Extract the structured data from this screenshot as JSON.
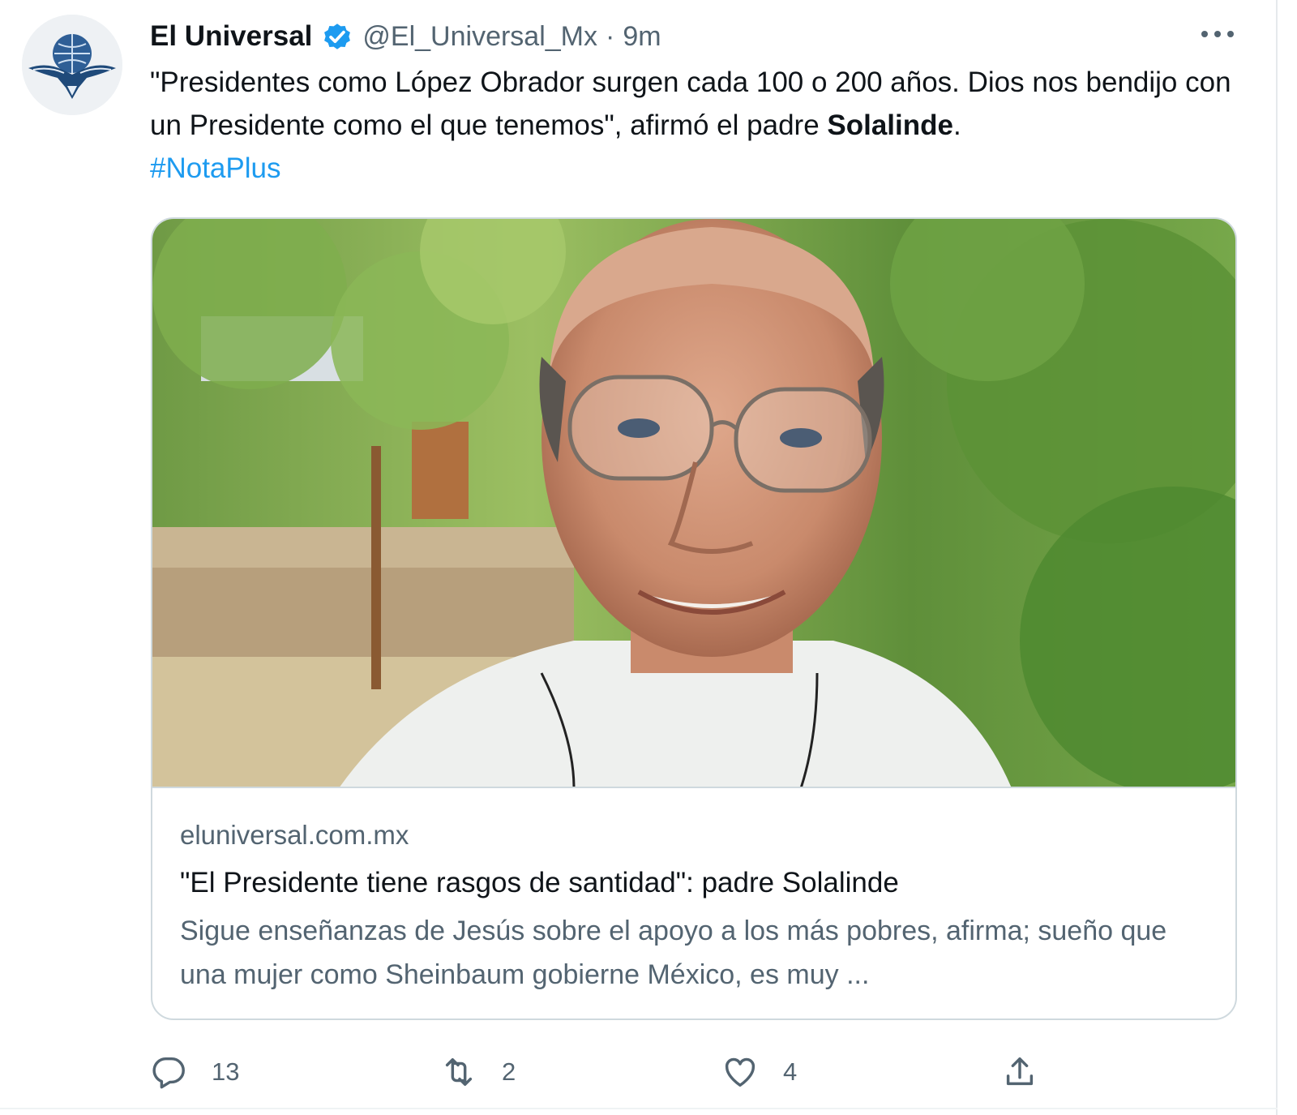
{
  "tweet": {
    "author": {
      "display_name": "El Universal",
      "handle": "@El_Universal_Mx",
      "separator": "·",
      "time": "9m"
    },
    "text": {
      "part1": "\"Presidentes como López Obrador surgen cada 100 o 200 años. Dios nos bendijo con un Presidente como el que tenemos\", afirmó el padre ",
      "bold": "Solalinde",
      "part2": ".",
      "hashtag": "#NotaPlus"
    },
    "card": {
      "domain": "eluniversal.com.mx",
      "title": "\"El Presidente tiene rasgos de santidad\": padre Solalinde",
      "description": "Sigue enseñanzas de Jesús sobre el apoyo a los más pobres, afirma; sueño que una mujer como Sheinbaum gobierne México, es muy ..."
    },
    "actions": {
      "replies": "13",
      "retweets": "2",
      "likes": "4"
    }
  },
  "colors": {
    "text": "#0f1419",
    "secondary": "#536471",
    "link": "#1d9bf0",
    "border": "#cfd9de",
    "verified": "#1d9bf0"
  },
  "icons": {
    "verified": "verified-badge-icon",
    "more": "more-options-icon",
    "reply": "reply-icon",
    "retweet": "retweet-icon",
    "like": "heart-icon",
    "share": "share-icon"
  }
}
